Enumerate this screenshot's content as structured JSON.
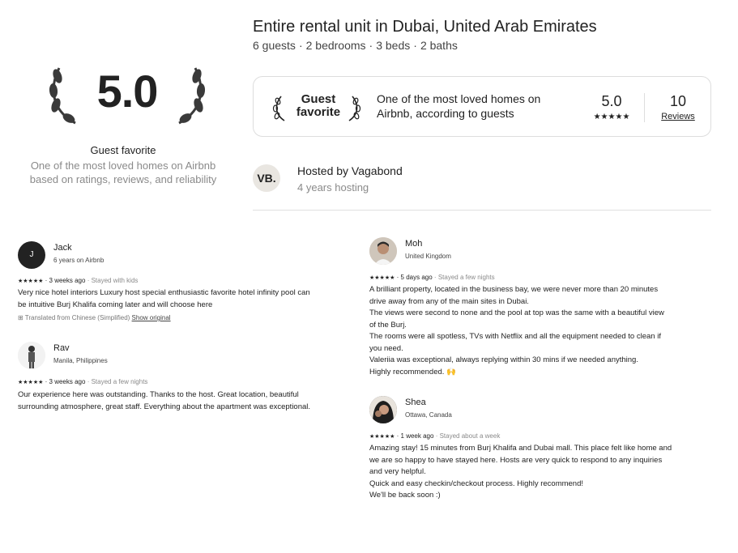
{
  "header": {
    "title": "Entire rental unit in Dubai, United Arab Emirates",
    "details": [
      "6 guests",
      "2 bedrooms",
      "3 beds",
      "2 baths"
    ]
  },
  "rating_block": {
    "score": "5.0",
    "label": "Guest favorite",
    "description": "One of the most loved homes on Airbnb based on ratings, reviews, and reliability"
  },
  "gf_card": {
    "badge_line1": "Guest",
    "badge_line2": "favorite",
    "loved_text": "One of the most loved homes on Airbnb, according to guests",
    "score": "5.0",
    "stars": "★★★★★",
    "review_count": "10",
    "reviews_link": "Reviews"
  },
  "host": {
    "initials": "VB.",
    "name": "Hosted by Vagabond",
    "years": "4 years hosting"
  },
  "reviews": [
    {
      "name": "Jack",
      "sub": "6 years on Airbnb",
      "avatar_initial": "J",
      "stars": "★★★★★",
      "when": "3 weeks ago",
      "stay": "Stayed with kids",
      "body": "Very nice hotel interiors Luxury host special enthusiastic favorite hotel infinity pool can\nbe intuitive Burj Khalifa coming later and will choose here",
      "translated": "Translated from Chinese (Simplified)",
      "show_original": "Show original"
    },
    {
      "name": "Rav",
      "sub": "Manila, Philippines",
      "stars": "★★★★★",
      "when": "3 weeks ago",
      "stay": "Stayed a few nights",
      "body": "Our experience here was outstanding. Thanks to the host. Great location, beautiful\nsurrounding atmosphere, great staff. Everything about the apartment was exceptional."
    },
    {
      "name": "Moh",
      "sub": "United Kingdom",
      "stars": "★★★★★",
      "when": "5 days ago",
      "stay": "Stayed a few nights",
      "body": "A brilliant property, located in the business bay, we were never more than 20 minutes\ndrive away from any of the main sites in Dubai.\nThe views were second to none and the pool at top was the same with a beautiful view\nof the Burj.\nThe rooms were all spotless, TVs with Netflix and all the equipment needed to clean if\nyou need.\nValeriia was exceptional, always replying within 30 mins if we needed anything.\nHighly recommended. 🙌"
    },
    {
      "name": "Shea",
      "sub": "Ottawa, Canada",
      "stars": "★★★★★",
      "when": "1 week ago",
      "stay": "Stayed about a week",
      "body": "Amazing stay! 15 minutes from Burj Khalifa and Dubai mall. This place felt like home and\nwe are so happy to have stayed here. Hosts are very quick to respond to any inquiries\nand very helpful.\nQuick and easy checkin/checkout process. Highly recommend!\nWe'll be back soon :)"
    }
  ],
  "separator": "·",
  "icons": {
    "laurel": "laurel-icon",
    "translate": "translate-icon"
  }
}
